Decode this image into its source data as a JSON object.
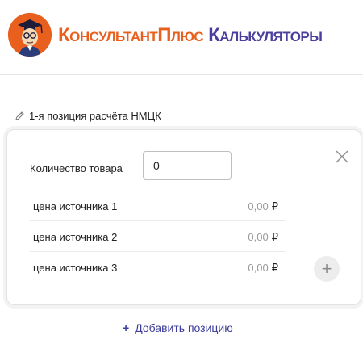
{
  "header": {
    "brand_primary": "КонсультантПлюс",
    "brand_secondary": "Калькуляторы",
    "logo_icon": "consultantplus-mascot-icon",
    "accent_color": "#e9601e",
    "secondary_color": "#4b3f9e"
  },
  "position": {
    "title": "1-я позиция расчёта НМЦК",
    "edit_icon": "pencil-icon"
  },
  "card": {
    "quantity_label": "Количество товара",
    "quantity_value": "0",
    "close_icon": "close-icon",
    "sources": [
      {
        "label": "цена источника 1",
        "value": "0,00",
        "currency": "₽"
      },
      {
        "label": "цена источника 2",
        "value": "0,00",
        "currency": "₽"
      },
      {
        "label": "цена источника 3",
        "value": "0,00",
        "currency": "₽"
      }
    ],
    "add_source_icon": "plus-icon",
    "add_source_symbol": "+"
  },
  "footer": {
    "add_position_symbol": "+",
    "add_position_label": "Добавить позицию"
  }
}
